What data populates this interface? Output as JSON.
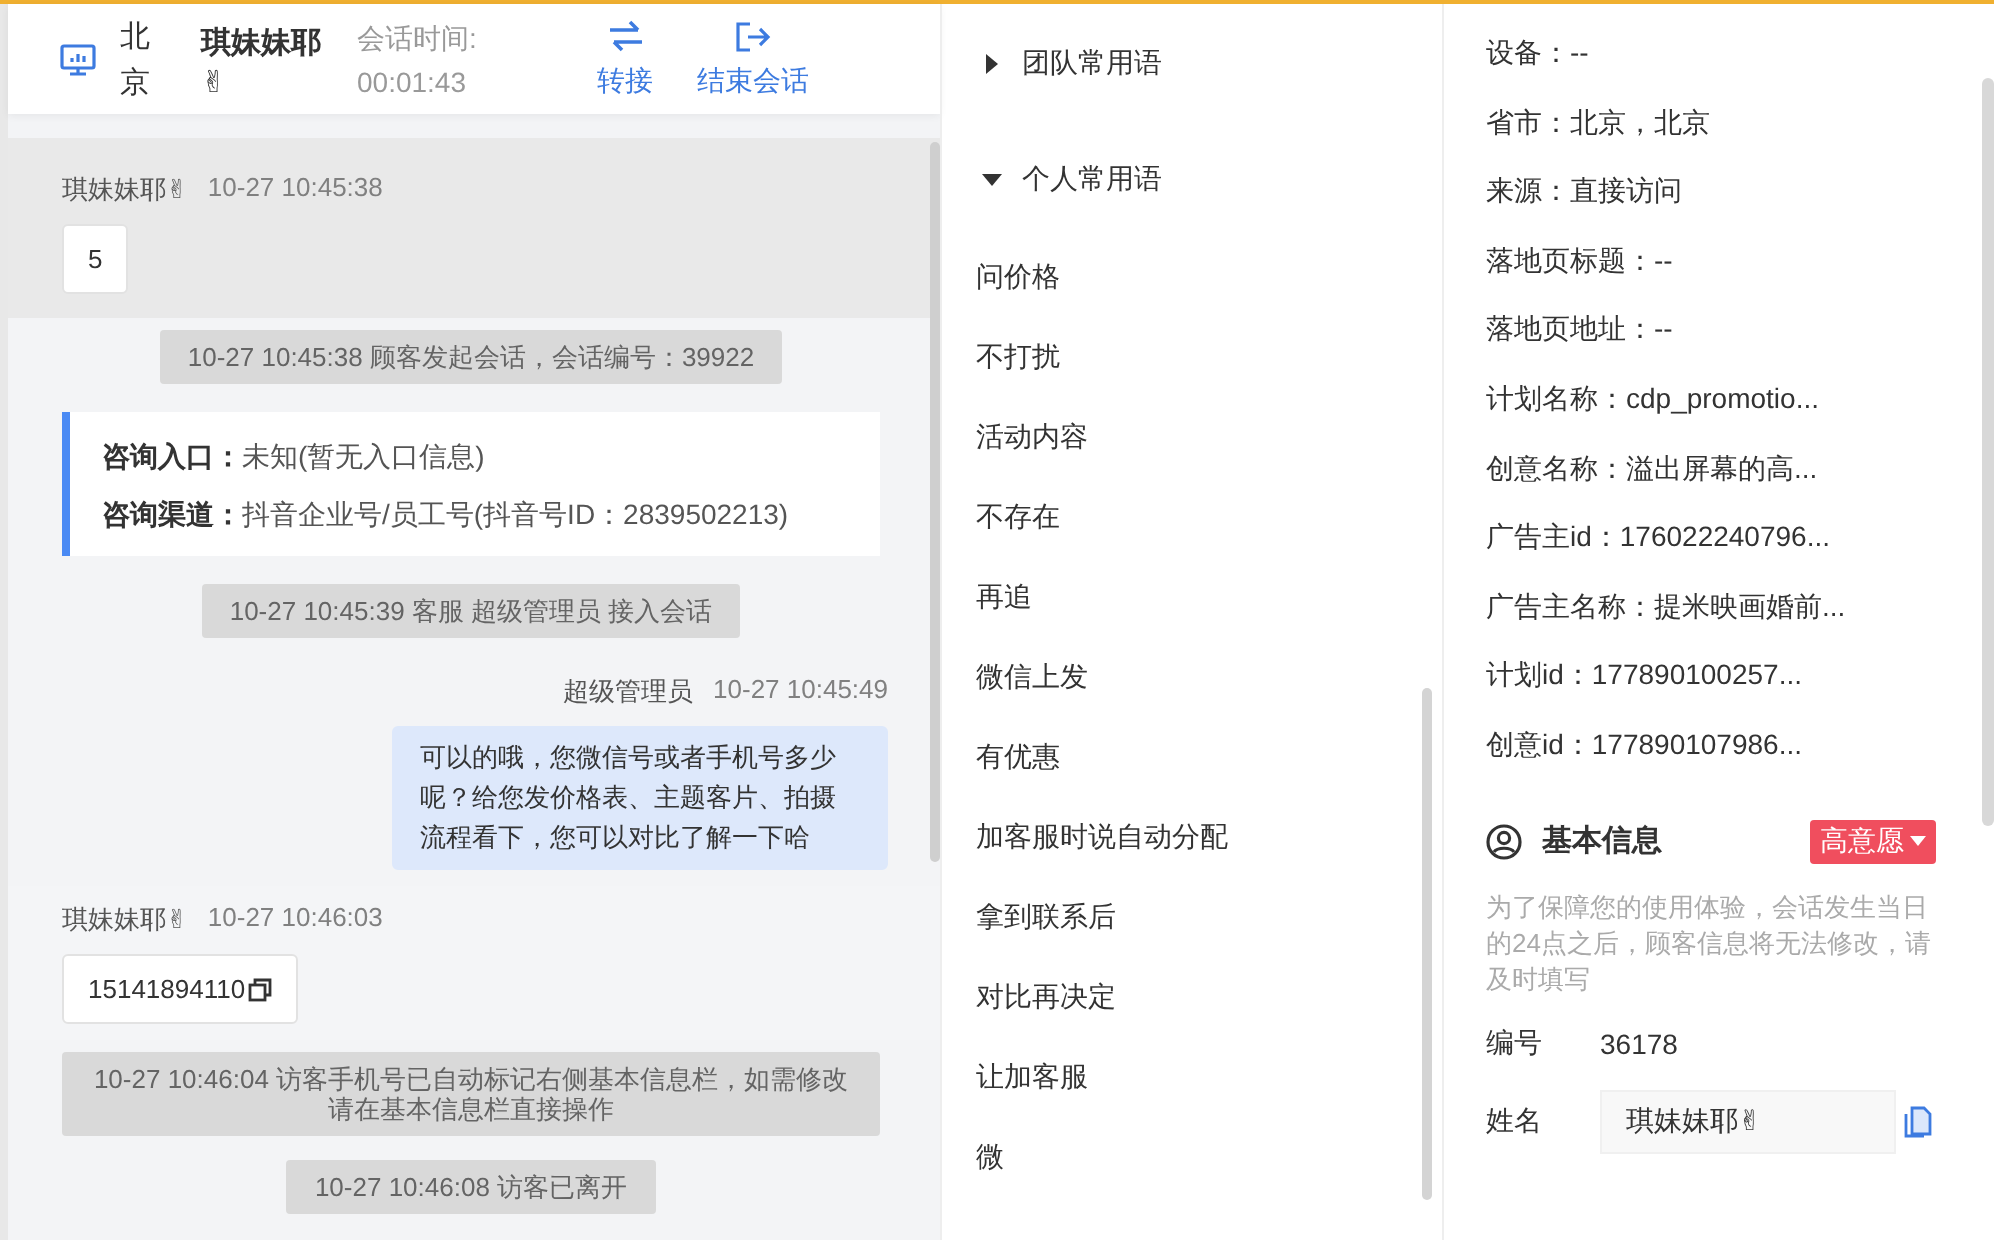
{
  "header": {
    "location": "北京",
    "customer": "琪妹妹耶✌",
    "duration_label": "会话时间:",
    "duration": "00:01:43",
    "actions": [
      {
        "kind": "transfer",
        "label": "转接"
      },
      {
        "kind": "end",
        "label": "结束会话"
      }
    ]
  },
  "chat": {
    "messages": [
      {
        "kind": "customer",
        "sender": "琪妹妹耶✌",
        "time": "10-27 10:45:38",
        "text": "5",
        "highlighted": true,
        "copyable": false
      },
      {
        "kind": "system",
        "text": "10-27 10:45:38 顾客发起会话，会话编号：39922"
      },
      {
        "kind": "info",
        "rows": [
          {
            "label": "咨询入口：",
            "value": "未知(暂无入口信息)"
          },
          {
            "label": "咨询渠道：",
            "value": "抖音企业号/员工号(抖音号ID：2839502213)"
          }
        ]
      },
      {
        "kind": "system",
        "text": "10-27 10:45:39 客服 超级管理员 接入会话"
      },
      {
        "kind": "agent",
        "sender": "超级管理员",
        "time": "10-27 10:45:49",
        "text": "可以的哦，您微信号或者手机号多少呢？给您发价格表、主题客片、拍摄流程看下，您可以对比了解一下哈"
      },
      {
        "kind": "customer",
        "sender": "琪妹妹耶✌",
        "time": "10-27 10:46:03",
        "text": "15141894110",
        "highlighted": false,
        "copyable": true
      },
      {
        "kind": "system",
        "text": "10-27 10:46:04 访客手机号已自动标记右侧基本信息栏，如需修改请在基本信息栏直接操作"
      },
      {
        "kind": "system",
        "text": "10-27 10:46:08 访客已离开"
      }
    ]
  },
  "phrases": {
    "groups": [
      {
        "title": "团队常用语",
        "expanded": false
      },
      {
        "title": "个人常用语",
        "expanded": true,
        "items": [
          "问价格",
          "不打扰",
          "活动内容",
          "不存在",
          "再追",
          "微信上发",
          "有优惠",
          "加客服时说自动分配",
          "拿到联系后",
          "对比再决定",
          "让加客服",
          "微"
        ]
      }
    ]
  },
  "visitor_info": {
    "fields": [
      "设备：--",
      "省市：北京，北京",
      "来源：直接访问",
      "落地页标题：--",
      "落地页地址：--",
      "计划名称：cdp_promotio...",
      "创意名称：溢出屏幕的高...",
      "广告主id：176022240796...",
      "广告主名称：提米映画婚前...",
      "计划id：177890100257...",
      "创意id：177890107986..."
    ]
  },
  "basic_info": {
    "title": "基本信息",
    "intent": "高意愿",
    "notice": "为了保障您的使用体验，会话发生当日的24点之后，顾客信息将无法修改，请及时填写",
    "fields": [
      {
        "kind": "text",
        "label": "编号",
        "value": "36178"
      },
      {
        "kind": "input",
        "label": "姓名",
        "value": "琪妹妹耶✌"
      }
    ]
  }
}
